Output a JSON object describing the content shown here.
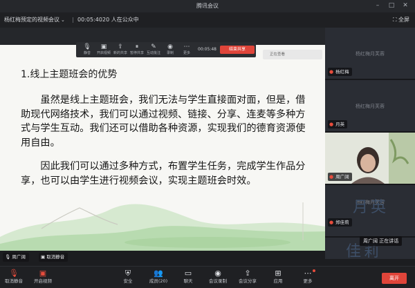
{
  "window": {
    "title": "腾讯会议"
  },
  "infobar": {
    "meeting_name": "杨红梅预定的视频会议",
    "duration": "00:05:40",
    "participants": "20 人在公众中",
    "fullscreen_label": "全屏"
  },
  "sharebar": {
    "items": [
      {
        "icon": "mic-icon",
        "label": "静音"
      },
      {
        "icon": "camera-icon",
        "label": "开启视频"
      },
      {
        "icon": "share-icon",
        "label": "新的共享"
      },
      {
        "icon": "pause-icon",
        "label": "暂停共享"
      },
      {
        "icon": "annotate-icon",
        "label": "互动批注"
      },
      {
        "icon": "record-icon",
        "label": "录制"
      },
      {
        "icon": "more-icon",
        "label": "更多"
      }
    ],
    "timer": "00:05:48",
    "stop_label": "结束共享",
    "view_label": "正在查看"
  },
  "slide": {
    "title": "1.线上主题班会的优势",
    "paragraph1": "虽然是线上主题班会，我们无法与学生直接面对面，但是，借助现代网络技术，我们可以通过视频、链接、分享、连麦等多种方式与学生互动。我们还可以借助各种资源，实现我们的德育资源使用自由。",
    "paragraph2": "因此我们可以通过多种方式，布置学生任务，完成学生作品分享，也可以由学生进行视频会议，实现主题班会时效。"
  },
  "share_nametags": [
    {
      "name": "周广阔"
    },
    {
      "name": "取消静音"
    }
  ],
  "gallery": {
    "tiles": [
      {
        "name": "杨红梅",
        "watermark": "杨红梅月芙蓉"
      },
      {
        "name": "月英",
        "watermark": "杨红梅月芙蓉"
      },
      {
        "name": "周广阔",
        "watermark": ""
      },
      {
        "name": "郑佳莉",
        "watermark": "杨红梅月芙蓉",
        "big_text": "月英",
        "speaking": "周广阔 正在讲话"
      },
      {
        "name": "",
        "watermark": "",
        "big_text": "佳莉"
      }
    ]
  },
  "toolbar": {
    "items": [
      {
        "icon": "mic-icon",
        "label": "取消静音"
      },
      {
        "icon": "camera-icon",
        "label": "开启视频"
      },
      {
        "icon": "security-icon",
        "label": "安全"
      },
      {
        "icon": "members-icon",
        "label": "成员(20)"
      },
      {
        "icon": "chat-icon",
        "label": "聊天"
      },
      {
        "icon": "record-icon",
        "label": "会议录制"
      },
      {
        "icon": "share-icon",
        "label": "会议分享"
      },
      {
        "icon": "apps-icon",
        "label": "应用"
      },
      {
        "icon": "more-icon",
        "label": "更多"
      }
    ],
    "end_label": "离开"
  },
  "colors": {
    "accent_red": "#e0453a",
    "background": "#1c1d20",
    "slide_bg": "#f7f7f4"
  }
}
